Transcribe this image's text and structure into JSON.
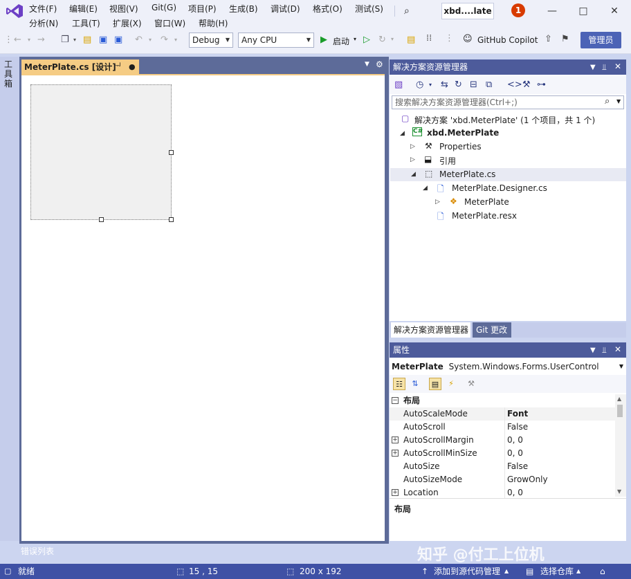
{
  "menu": {
    "row1": [
      "文件(F)",
      "编辑(E)",
      "视图(V)",
      "Git(G)",
      "项目(P)",
      "生成(B)",
      "调试(D)",
      "格式(O)",
      "测试(S)"
    ],
    "row2": [
      "分析(N)",
      "工具(T)",
      "扩展(X)",
      "窗口(W)",
      "帮助(H)"
    ]
  },
  "titlebar": {
    "solution_title": "xbd....late",
    "notification_count": "1"
  },
  "toolbar": {
    "config": "Debug",
    "platform": "Any CPU",
    "start_label": "启动",
    "copilot_label": "GitHub Copilot",
    "admin_label": "管理员"
  },
  "toolbox_label": "工具箱",
  "document": {
    "tab_label": "MeterPlate.cs [设计]",
    "pin_glyph": "ᅯ",
    "modified_glyph": "●"
  },
  "solution_explorer": {
    "title": "解决方案资源管理器",
    "search_placeholder": "搜索解决方案资源管理器(Ctrl+;)",
    "solution_line": "解决方案 'xbd.MeterPlate' (1 个项目，共 1 个)",
    "project": "xbd.MeterPlate",
    "items": [
      "Properties",
      "引用",
      "MeterPlate.cs",
      "MeterPlate.Designer.cs",
      "MeterPlate",
      "MeterPlate.resx"
    ],
    "tabs": [
      "解决方案资源管理器",
      "Git 更改"
    ]
  },
  "properties": {
    "title": "属性",
    "object_name": "MeterPlate",
    "object_type": "System.Windows.Forms.UserControl",
    "category": "布局",
    "rows": [
      {
        "name": "AutoScaleMode",
        "value": "Font"
      },
      {
        "name": "AutoScroll",
        "value": "False"
      },
      {
        "name": "AutoScrollMargin",
        "value": "0, 0"
      },
      {
        "name": "AutoScrollMinSize",
        "value": "0, 0"
      },
      {
        "name": "AutoSize",
        "value": "False"
      },
      {
        "name": "AutoSizeMode",
        "value": "GrowOnly"
      },
      {
        "name": "Location",
        "value": "0, 0"
      }
    ],
    "description_title": "布局"
  },
  "error_list": "错误列表",
  "status": {
    "ready": "就绪",
    "position": "15 , 15",
    "size": "200 x 192",
    "add_source": "添加到源代码管理",
    "select_repo": "选择仓库"
  },
  "watermark": "知乎 @付工上位机"
}
